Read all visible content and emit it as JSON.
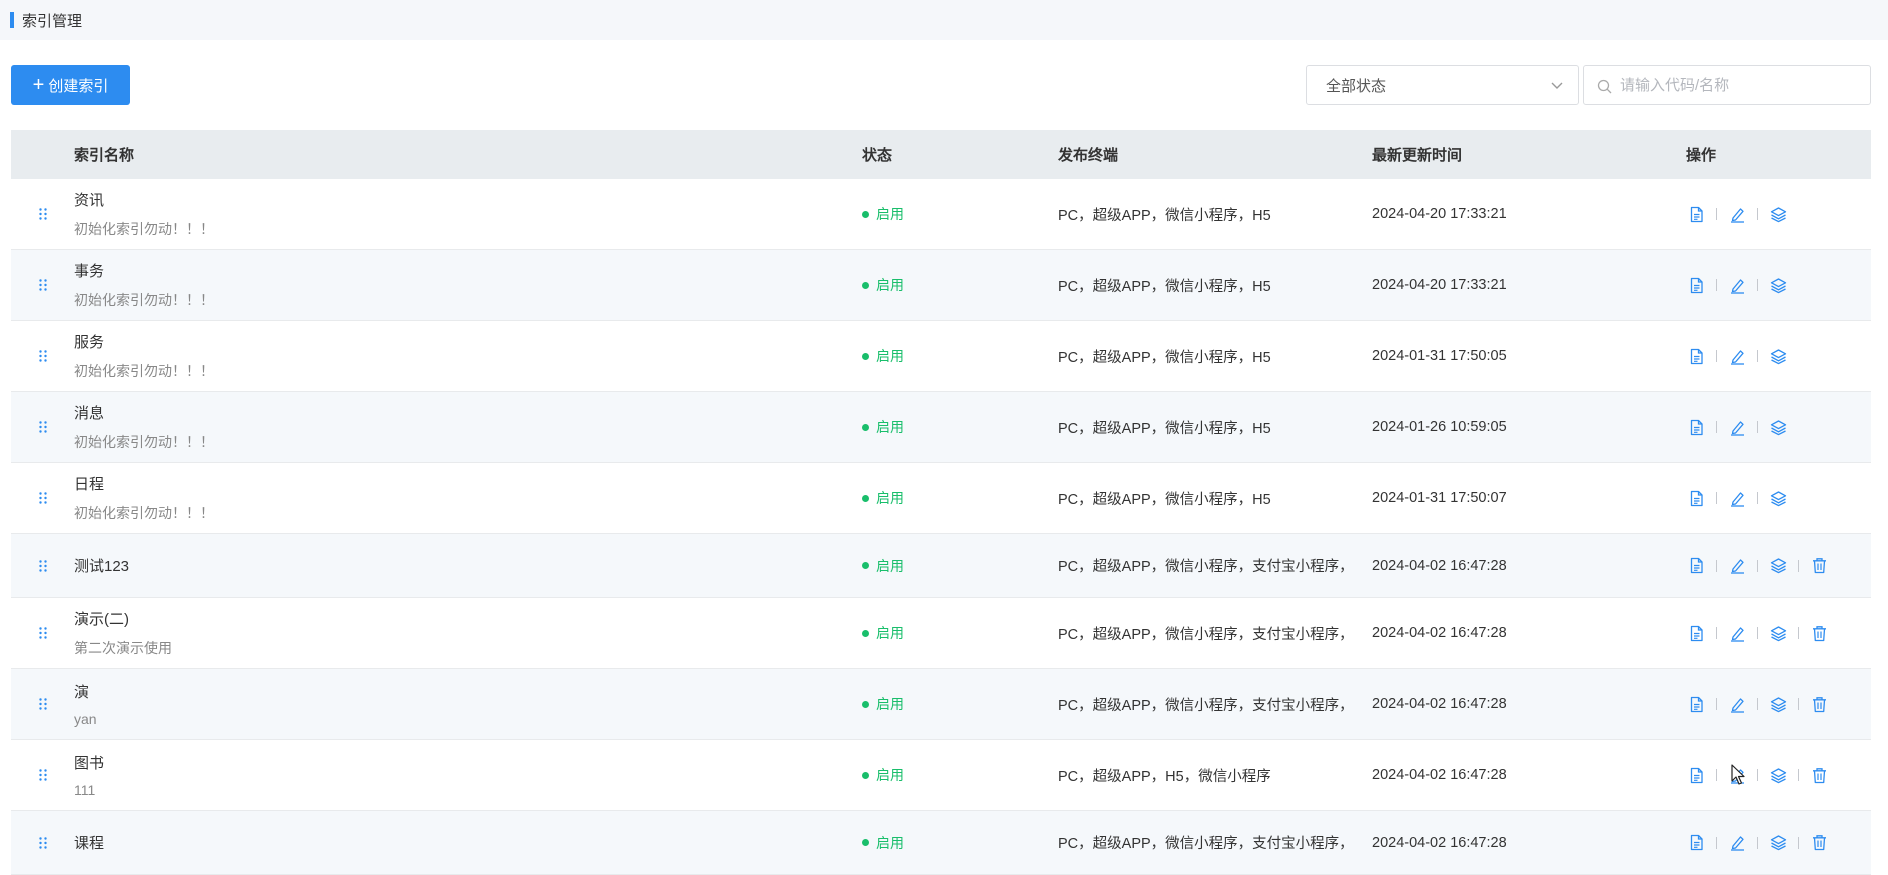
{
  "page": {
    "title": "索引管理"
  },
  "toolbar": {
    "create_label": "创建索引",
    "status_select": "全部状态",
    "search_placeholder": "请输入代码/名称"
  },
  "table": {
    "headers": [
      "索引名称",
      "状态",
      "发布终端",
      "最新更新时间",
      "操作"
    ],
    "rows": [
      {
        "name": "资讯",
        "desc": "初始化索引勿动！！！",
        "status": "启用",
        "terminals": "PC，超级APP，微信小程序，H5",
        "updated": "2024-04-20 17:33:21",
        "deletable": false
      },
      {
        "name": "事务",
        "desc": "初始化索引勿动！！！",
        "status": "启用",
        "terminals": "PC，超级APP，微信小程序，H5",
        "updated": "2024-04-20 17:33:21",
        "deletable": false
      },
      {
        "name": "服务",
        "desc": "初始化索引勿动！！！",
        "status": "启用",
        "terminals": "PC，超级APP，微信小程序，H5",
        "updated": "2024-01-31 17:50:05",
        "deletable": false
      },
      {
        "name": "消息",
        "desc": "初始化索引勿动！！！",
        "status": "启用",
        "terminals": "PC，超级APP，微信小程序，H5",
        "updated": "2024-01-26 10:59:05",
        "deletable": false
      },
      {
        "name": "日程",
        "desc": "初始化索引勿动！！！",
        "status": "启用",
        "terminals": "PC，超级APP，微信小程序，H5",
        "updated": "2024-01-31 17:50:07",
        "deletable": false
      },
      {
        "name": "测试123",
        "desc": "",
        "status": "启用",
        "terminals": "PC，超级APP，微信小程序，支付宝小程序，",
        "updated": "2024-04-02 16:47:28",
        "deletable": true
      },
      {
        "name": "演示(二)",
        "desc": "第二次演示使用",
        "status": "启用",
        "terminals": "PC，超级APP，微信小程序，支付宝小程序，",
        "updated": "2024-04-02 16:47:28",
        "deletable": true
      },
      {
        "name": "演",
        "desc": "yan",
        "status": "启用",
        "terminals": "PC，超级APP，微信小程序，支付宝小程序，",
        "updated": "2024-04-02 16:47:28",
        "deletable": true
      },
      {
        "name": "图书",
        "desc": "111",
        "status": "启用",
        "terminals": "PC，超级APP，H5，微信小程序",
        "updated": "2024-04-02 16:47:28",
        "deletable": true
      },
      {
        "name": "课程",
        "desc": "",
        "status": "启用",
        "terminals": "PC，超级APP，微信小程序，支付宝小程序，",
        "updated": "2024-04-02 16:47:28",
        "deletable": true
      }
    ]
  },
  "colors": {
    "primary": "#2d8cf0",
    "enabled": "#19be6b",
    "icon": "#2d8cf0"
  },
  "icons": [
    "drag-handle-icon",
    "document-icon",
    "edit-icon",
    "layers-icon",
    "trash-icon",
    "search-icon",
    "chevron-down-icon",
    "mouse-cursor-icon"
  ]
}
